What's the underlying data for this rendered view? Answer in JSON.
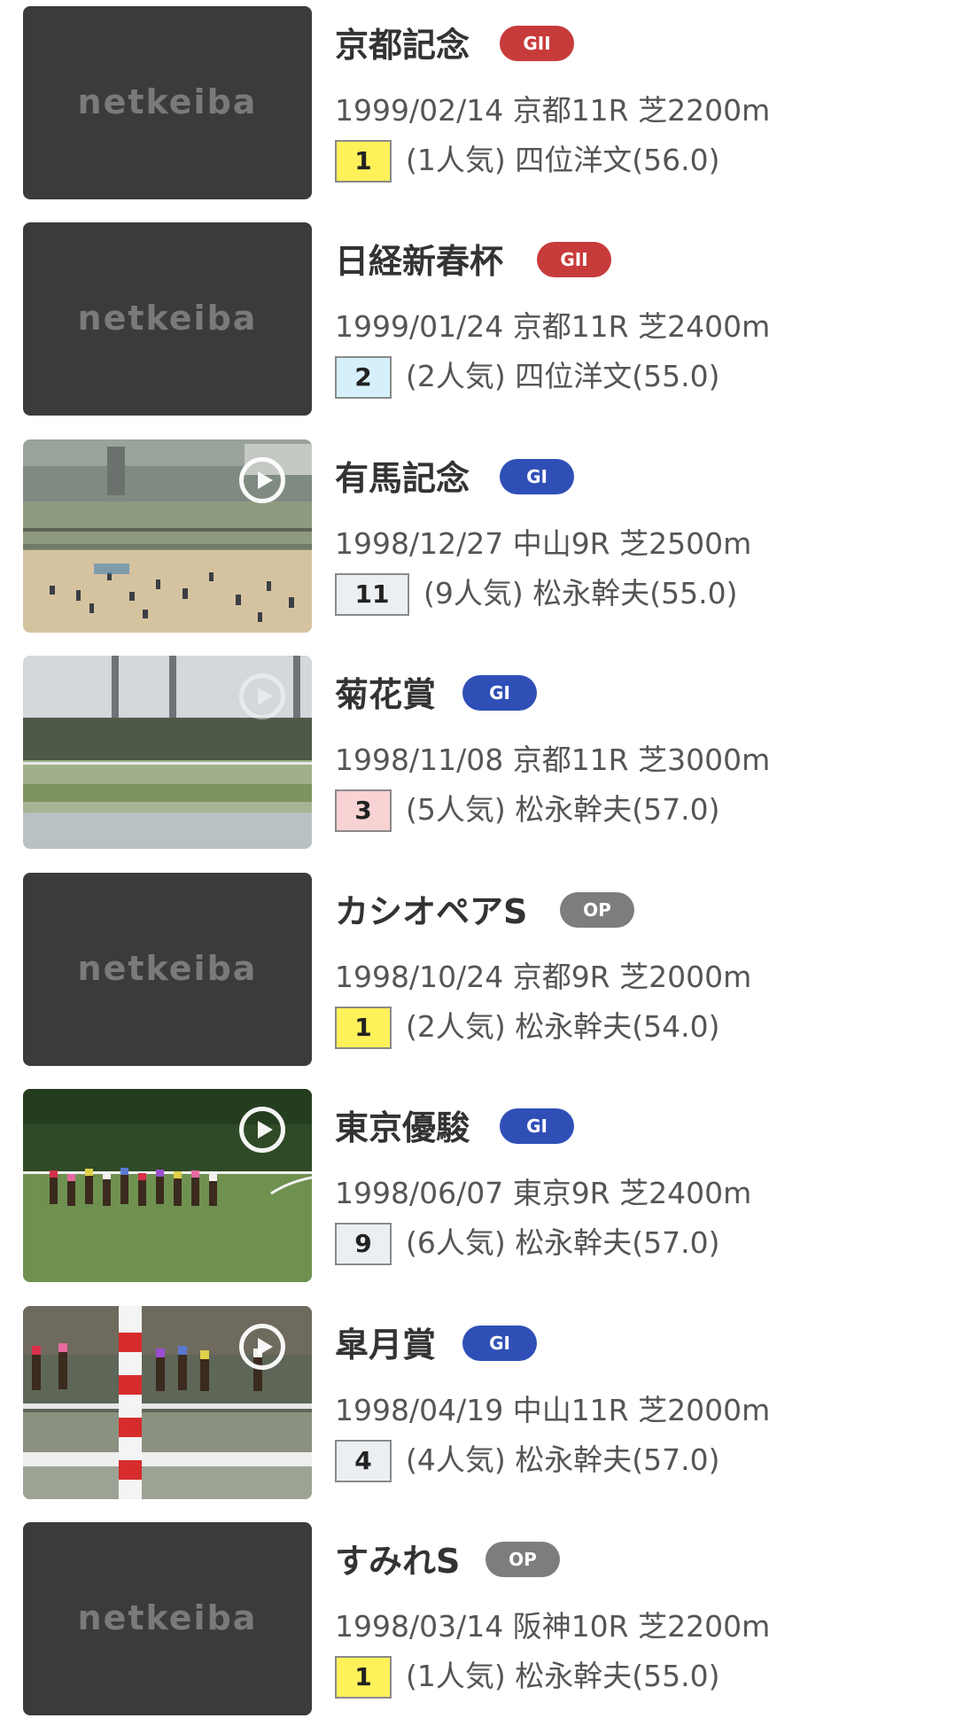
{
  "placeholder_logo": "netkeiba",
  "grade_colors": {
    "GII": "#c83b3b",
    "GI": "#2f4fb7",
    "OP": "#7d7d7d"
  },
  "place_colors": {
    "1": "#fff15a",
    "2": "#d6f0fb",
    "3": "#f9d3d3",
    "other": "#eceff2"
  },
  "races": [
    {
      "name": "京都記念",
      "grade": "GII",
      "info": "1999/02/14 京都11R 芝2200m",
      "place": "1",
      "jockey": "(1人気) 四位洋文(56.0)",
      "thumbnail": "netkeiba-placeholder",
      "has_video": false
    },
    {
      "name": "日経新春杯",
      "grade": "GII",
      "info": "1999/01/24 京都11R 芝2400m",
      "place": "2",
      "jockey": "(2人気) 四位洋文(55.0)",
      "thumbnail": "netkeiba-placeholder",
      "has_video": false
    },
    {
      "name": "有馬記念",
      "grade": "GI",
      "info": "1998/12/27 中山9R 芝2500m",
      "place": "11",
      "jockey": "(9人気) 松永幹夫(55.0)",
      "thumbnail": "video-still-grandstand",
      "has_video": true
    },
    {
      "name": "菊花賞",
      "grade": "GI",
      "info": "1998/11/08 京都11R 芝3000m",
      "place": "3",
      "jockey": "(5人気) 松永幹夫(57.0)",
      "thumbnail": "video-still-course-towers",
      "has_video": true
    },
    {
      "name": "カシオペアS",
      "grade": "OP",
      "info": "1998/10/24 京都9R 芝2000m",
      "place": "1",
      "jockey": "(2人気) 松永幹夫(54.0)",
      "thumbnail": "netkeiba-placeholder",
      "has_video": false
    },
    {
      "name": "東京優駿",
      "grade": "GI",
      "info": "1998/06/07 東京9R 芝2400m",
      "place": "9",
      "jockey": "(6人気) 松永幹夫(57.0)",
      "thumbnail": "video-still-field-turn",
      "has_video": true
    },
    {
      "name": "皐月賞",
      "grade": "GI",
      "info": "1998/04/19 中山11R 芝2000m",
      "place": "4",
      "jockey": "(4人気) 松永幹夫(57.0)",
      "thumbnail": "video-still-rail-post",
      "has_video": true
    },
    {
      "name": "すみれS",
      "grade": "OP",
      "info": "1998/03/14 阪神10R 芝2200m",
      "place": "1",
      "jockey": "(1人気) 松永幹夫(55.0)",
      "thumbnail": "netkeiba-placeholder",
      "has_video": false
    }
  ]
}
